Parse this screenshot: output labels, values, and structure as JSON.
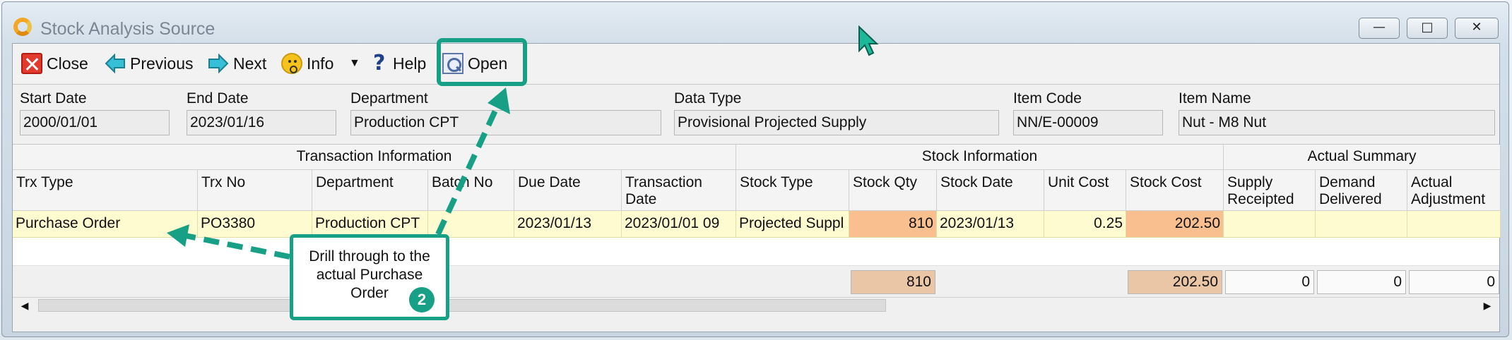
{
  "window": {
    "title": "Stock Analysis Source",
    "min_glyph": "—",
    "max_glyph": "□",
    "close_glyph": "✕"
  },
  "toolbar": {
    "close": "Close",
    "previous": "Previous",
    "next": "Next",
    "info": "Info",
    "dropdown": "▼",
    "help": "Help",
    "open": "Open"
  },
  "fields": [
    {
      "label": "Start Date",
      "value": "2000/01/01"
    },
    {
      "label": "End Date",
      "value": "2023/01/16"
    },
    {
      "label": "Department",
      "value": "Production CPT"
    },
    {
      "label": "Data Type",
      "value": "Provisional Projected Supply"
    },
    {
      "label": "Item Code",
      "value": "NN/E-00009"
    },
    {
      "label": "Item Name",
      "value": "Nut - M8 Nut"
    }
  ],
  "grid": {
    "groups": [
      "Transaction Information",
      "Stock Information",
      "Actual Summary"
    ],
    "columns": [
      "Trx Type",
      "Trx No",
      "Department",
      "Batch No",
      "Due Date",
      "Transaction Date",
      "Stock Type",
      "Stock Qty",
      "Stock Date",
      "Unit Cost",
      "Stock Cost",
      "Supply Receipted",
      "Demand Delivered",
      "Actual Adjustment"
    ],
    "row": [
      "Purchase Order",
      "PO3380",
      "Production CPT",
      "",
      "2023/01/13",
      "2023/01/01 09",
      "Projected Suppl",
      "810",
      "2023/01/13",
      "0.25",
      "202.50",
      "",
      "",
      ""
    ],
    "totals": {
      "stock_qty": "810",
      "stock_cost": "202.50",
      "supply_receipted": "0",
      "demand_delivered": "0",
      "actual_adjustment": "0"
    }
  },
  "scrollbar": {
    "left": "◀",
    "right": "▶"
  },
  "callout": {
    "text": "Drill through to the actual Purchase Order",
    "badge": "2"
  },
  "colors": {
    "accent": "#17a085",
    "row_highlight": "#fffbd0",
    "cell_highlight": "#f9bf8e",
    "total_highlight": "#eac5a6"
  }
}
